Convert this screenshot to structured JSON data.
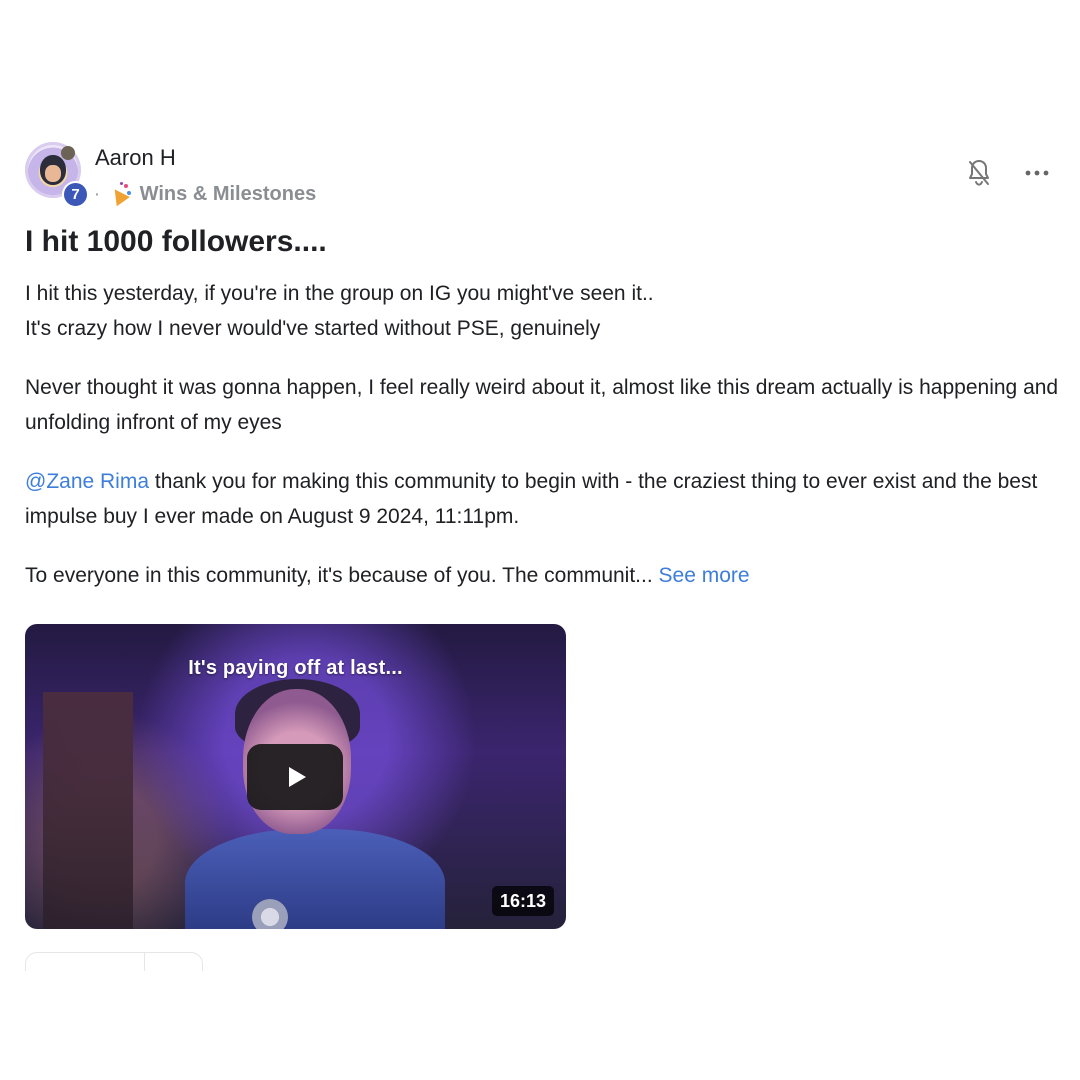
{
  "post": {
    "author": {
      "name": "Aaron H",
      "level": "7"
    },
    "category": {
      "label": "Wins & Milestones",
      "icon": "party-popper-icon"
    },
    "title": "I hit 1000 followers....",
    "paragraphs": {
      "p1_line1": "I hit this yesterday, if you're in the group on IG you might've seen it..",
      "p1_line2": "It's crazy how I never would've started without PSE, genuinely",
      "p2": "Never thought it was gonna happen, I feel really weird about it, almost like this dream actually is happening and unfolding infront of my eyes",
      "p3_mention": "@Zane Rima",
      "p3_rest": " thank you for making this community to begin with - the craziest thing to ever exist and the best impulse buy I ever made on August 9 2024, 11:11pm.",
      "p4": "To everyone in this community, it's because of you. The communit... ",
      "see_more": "See more"
    },
    "video": {
      "overlay_text": "It's paying off at last...",
      "duration": "16:13"
    }
  },
  "icons": {
    "notification": "bell-off-icon",
    "more": "more-horizontal-icon",
    "play": "play-icon"
  }
}
